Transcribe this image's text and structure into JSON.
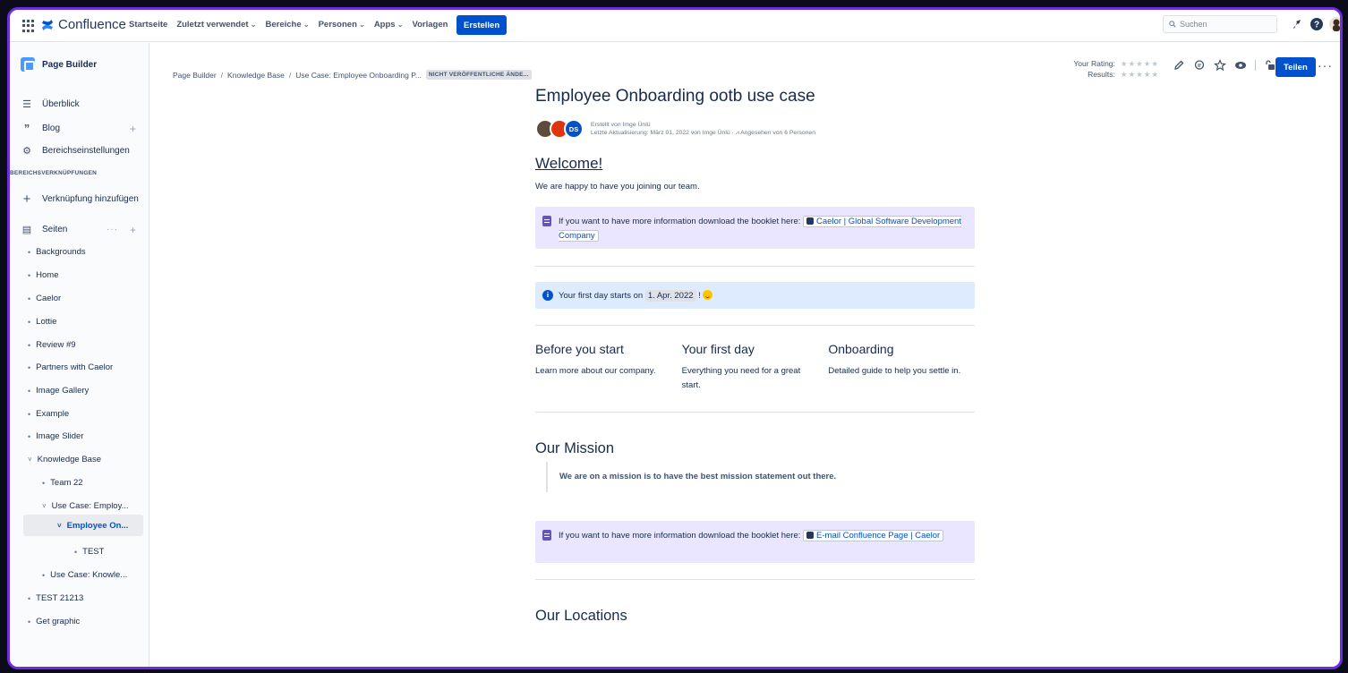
{
  "topnav": {
    "product_name": "Confluence",
    "items": [
      {
        "label": "Startseite",
        "dropdown": false
      },
      {
        "label": "Zuletzt verwendet",
        "dropdown": true
      },
      {
        "label": "Bereiche",
        "dropdown": true
      },
      {
        "label": "Personen",
        "dropdown": true
      },
      {
        "label": "Apps",
        "dropdown": true
      },
      {
        "label": "Vorlagen",
        "dropdown": false
      }
    ],
    "create_label": "Erstellen",
    "search_placeholder": "Suchen",
    "icons": [
      "app-switcher-icon",
      "notifications-icon",
      "help-icon",
      "profile-avatar"
    ]
  },
  "sidebar": {
    "space_name": "Page Builder",
    "main": [
      {
        "icon": "overview-icon",
        "label": "Überblick"
      },
      {
        "icon": "blog-quote-icon",
        "label": "Blog"
      },
      {
        "icon": "gear-icon",
        "label": "Bereichseinstellungen"
      }
    ],
    "shortcuts_heading": "BEREICHSVERKNÜPFUNGEN",
    "add_shortcut_label": "Verknüpfung hinzufügen",
    "pages_label": "Seiten",
    "tree": [
      {
        "label": "Backgrounds",
        "level": 0,
        "expanded": false
      },
      {
        "label": "Home",
        "level": 0,
        "expanded": false
      },
      {
        "label": "Caelor",
        "level": 0,
        "expanded": false
      },
      {
        "label": "Lottie",
        "level": 0,
        "expanded": false
      },
      {
        "label": "Review #9",
        "level": 0,
        "expanded": false
      },
      {
        "label": "Partners with Caelor",
        "level": 0,
        "expanded": false
      },
      {
        "label": "Image Gallery",
        "level": 0,
        "expanded": false
      },
      {
        "label": "Example",
        "level": 0,
        "expanded": false
      },
      {
        "label": "Image Slider",
        "level": 0,
        "expanded": false
      },
      {
        "label": "Knowledge Base",
        "level": 0,
        "expanded": true
      },
      {
        "label": "Team 22",
        "level": 1,
        "expanded": false
      },
      {
        "label": "Use Case: Employ...",
        "level": 1,
        "expanded": true
      },
      {
        "label": "Employee On...",
        "level": 2,
        "expanded": true,
        "selected": true
      },
      {
        "label": "TEST",
        "level": 3,
        "expanded": false
      },
      {
        "label": "Use Case: Knowle...",
        "level": 1,
        "expanded": false
      },
      {
        "label": "TEST 21213",
        "level": 0,
        "expanded": false
      },
      {
        "label": "Get graphic",
        "level": 0,
        "expanded": false
      }
    ]
  },
  "breadcrumb": {
    "items": [
      "Page Builder",
      "Knowledge Base",
      "Use Case: Employee Onboarding P..."
    ],
    "draft_badge": "NICHT VERÖFFENTLICHE ÄNDE..."
  },
  "rating": {
    "your_rating_label": "Your Rating:",
    "results_label": "Results:",
    "stars": "★★★★★",
    "your_rating_value": 0,
    "results_value": 0
  },
  "page_actions": {
    "share_label": "Teilen",
    "more_label": "···",
    "icons": [
      "edit-icon",
      "comment-icon",
      "star-icon",
      "watch-icon",
      "restrictions-icon"
    ]
  },
  "page": {
    "title": "Employee Onboarding ootb use case",
    "byline_created": "Erstellt von Imge Ünlü",
    "byline_updated": "Letzte Aktualisierung: März 01, 2022 von Imge Ünlü",
    "byline_views": "Angesehen von 6 Personen",
    "avatar_initials": "DS",
    "welcome_heading": "Welcome!",
    "welcome_text": "We are happy to have you joining our team.",
    "note1_text": "If you want to have more information download the booklet here:",
    "note1_link": "Caelor | Global Software Development Company",
    "info_text": "Your first day starts on",
    "info_date": "1. Apr. 2022",
    "info_after": "!",
    "columns": [
      {
        "title": "Before you start",
        "text": "Learn more about our company."
      },
      {
        "title": "Your first day",
        "text": "Everything you need for a great start."
      },
      {
        "title": "Onboarding",
        "text": "Detailed guide to help you settle in."
      }
    ],
    "mission_heading": "Our Mission",
    "mission_quote": "We are on a mission is to have the best mission statement out there.",
    "note2_text": "If you want to have more information download the booklet here:",
    "note2_link": "E-mail Confluence Page | Caelor",
    "locations_heading": "Our Locations"
  },
  "colors": {
    "brand": "#0052cc",
    "note_panel": "#eae6ff",
    "info_panel": "#deebff",
    "frame_border": "#6b2ee0"
  }
}
